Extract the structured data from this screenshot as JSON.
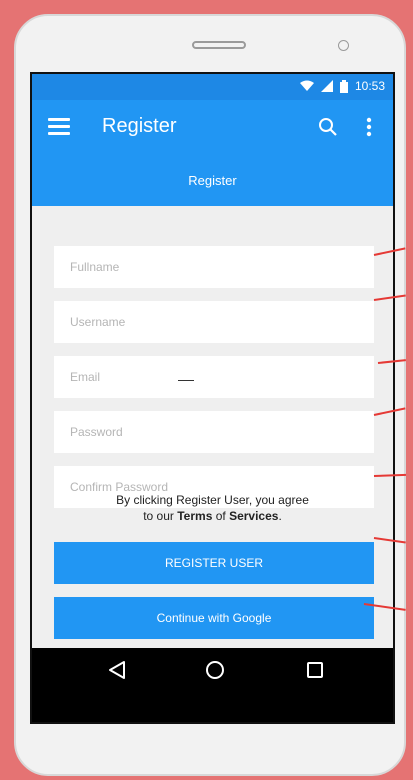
{
  "status_bar": {
    "time": "10:53"
  },
  "app_bar": {
    "title": "Register"
  },
  "tab": {
    "label": "Register"
  },
  "form": {
    "fullname_placeholder": "Fullname",
    "username_placeholder": "Username",
    "email_placeholder": "Email",
    "password_placeholder": "Password",
    "confirm_password_placeholder": "Confirm Password"
  },
  "buttons": {
    "register_label": "REGISTER USER",
    "google_label": "Continue with Google"
  },
  "agreement": {
    "line1": "By clicking Register User, you agree",
    "line2_prefix": "to our ",
    "terms": "Terms",
    "of": " of ",
    "services": "Services",
    "line2_suffix": "."
  },
  "icons": {
    "menu": "hamburger-icon",
    "search": "search-icon",
    "more": "more-vert-icon",
    "wifi": "wifi-icon",
    "signal": "signal-icon",
    "battery": "battery-icon",
    "back": "back-triangle-icon",
    "home": "home-circle-icon",
    "recents": "recents-square-icon"
  },
  "colors": {
    "primary": "#2196f3",
    "status_bar": "#1e88e5",
    "background": "#e57373",
    "pointer": "#e53935"
  }
}
